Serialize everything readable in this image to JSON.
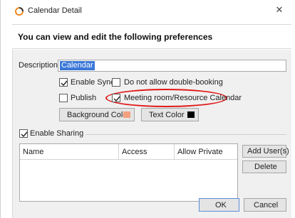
{
  "window": {
    "title": "Calendar Detail",
    "close_glyph": "✕",
    "icon": "calendar-app-icon"
  },
  "header": {
    "text": "You can view and edit the following preferences"
  },
  "form": {
    "description_label": "Description:",
    "description_value": "Calendar",
    "enable_sync": {
      "label": "Enable Sync",
      "checked": true
    },
    "no_double_booking": {
      "label": "Do not allow double-booking",
      "checked": false
    },
    "publish": {
      "label": "Publish",
      "checked": false
    },
    "meeting_room": {
      "label": "Meeting room/Resource Calendar",
      "checked": true,
      "highlighted": true
    },
    "background_color": {
      "label": "Background Color",
      "swatch": "#f4a07e"
    },
    "text_color": {
      "label": "Text Color",
      "swatch": "#000000"
    }
  },
  "sharing": {
    "label": "Enable Sharing",
    "checked": true,
    "columns": [
      "Name",
      "Access",
      "Allow Private"
    ],
    "rows": [],
    "add_user_label": "Add User(s)",
    "delete_label": "Delete"
  },
  "footer": {
    "ok_label": "OK",
    "cancel_label": "Cancel"
  },
  "colors": {
    "highlight_ellipse": "#e01818",
    "selection": "#3b78d8",
    "dialog_background": "#f0f0f0"
  }
}
